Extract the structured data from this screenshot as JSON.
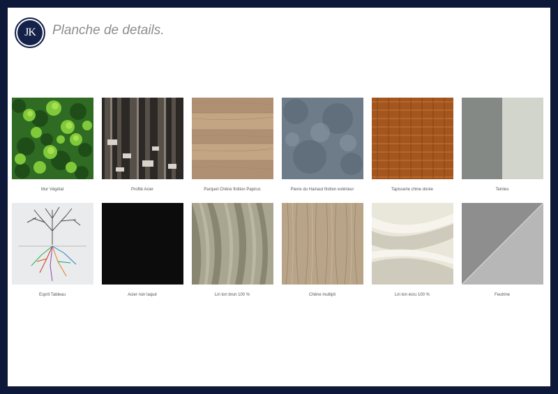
{
  "header": {
    "logo_text": "JK",
    "title": "Planche de details."
  },
  "colors": {
    "frame": "#0e1838",
    "logo": "#14224a",
    "title_text": "#8d8d8d"
  },
  "materials": [
    {
      "label": "Mur Végétal",
      "icon": "green-moss-swatch"
    },
    {
      "label": "Profilé Acier",
      "icon": "steel-profiles-swatch"
    },
    {
      "label": "Parquet Chêne finition Papirus",
      "icon": "oak-parquet-swatch"
    },
    {
      "label": "Pierre du Hainaut finition extérieur",
      "icon": "blue-stone-swatch"
    },
    {
      "label": "Tapisserie chine dorée",
      "icon": "woven-tapestry-swatch"
    },
    {
      "label": "Teintes",
      "icon": "color-tints-swatch"
    },
    {
      "label": "Esprit Tableau",
      "icon": "tree-artwork-swatch"
    },
    {
      "label": "Acier noir laqué",
      "icon": "black-steel-swatch"
    },
    {
      "label": "Lin ton brun 100 %",
      "icon": "brown-linen-swatch"
    },
    {
      "label": "Chêne multipli",
      "icon": "oak-multiply-swatch"
    },
    {
      "label": "Lin ton écru 100 %",
      "icon": "ecru-linen-swatch"
    },
    {
      "label": "Feutrine",
      "icon": "felt-swatch"
    }
  ]
}
